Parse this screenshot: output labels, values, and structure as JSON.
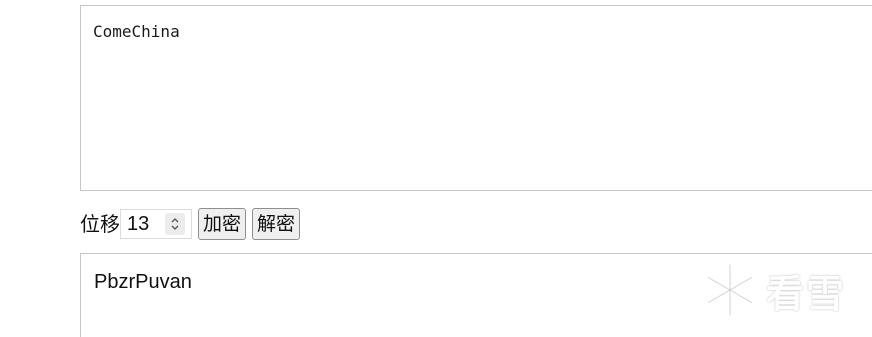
{
  "input": {
    "value": "ComeChina"
  },
  "controls": {
    "shift_label": "位移",
    "shift_value": "13",
    "encrypt_label": "加密",
    "decrypt_label": "解密"
  },
  "output": {
    "value": "PbzrPuvan"
  },
  "watermark": {
    "text": "看雪",
    "icon": "snowflake-icon"
  }
}
